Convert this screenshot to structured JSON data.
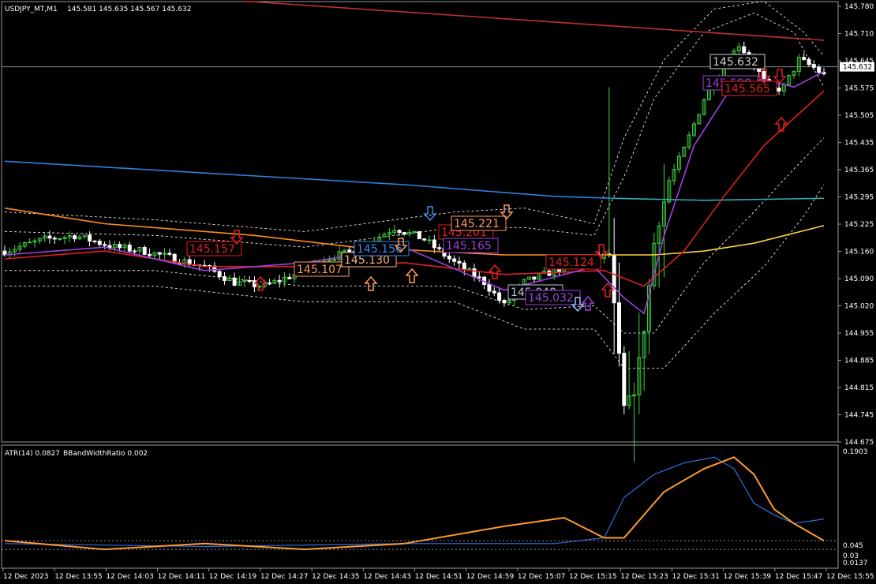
{
  "header": {
    "symbol": "USDJPY_MT,M1",
    "ohlc": "145.581 145.635 145.567 145.632"
  },
  "indicator_header": {
    "atr": "ATR(14) 0.0827",
    "bbwr": "BBandWidthRatio 0.002"
  },
  "colors": {
    "background": "#000000",
    "candle_up": "#3fcf3f",
    "candle_down": "#ffffff",
    "ma_red": "#e02020",
    "ma_purple": "#a040e0",
    "ma_orange": "#ff8c20",
    "ma_yellow": "#ffd040",
    "ma_blue": "#2f7fe0",
    "ma_teal": "#30b0b8",
    "ma_top": "#c03030",
    "bands": "#ffffff",
    "atr_line": "#2f6fe0",
    "bbwr_line": "#ff9a30"
  },
  "chart_data": [
    {
      "type": "candlestick",
      "title": "USDJPY_MT,M1",
      "ylim": [
        144.675,
        145.795
      ],
      "y_ticks": [
        "145.780",
        "145.710",
        "145.645",
        "145.575",
        "145.505",
        "145.435",
        "145.365",
        "145.295",
        "145.225",
        "145.160",
        "145.090",
        "145.020",
        "144.955",
        "144.885",
        "144.815",
        "144.745",
        "144.675"
      ],
      "current_price": "145.632",
      "x_ticks": [
        "12 Dec 2023",
        "12 Dec 13:55",
        "12 Dec 14:03",
        "12 Dec 14:11",
        "12 Dec 14:19",
        "12 Dec 14:27",
        "12 Dec 14:35",
        "12 Dec 14:43",
        "12 Dec 14:51",
        "12 Dec 14:59",
        "12 Dec 15:07",
        "12 Dec 15:15",
        "12 Dec 15:23",
        "12 Dec 15:31",
        "12 Dec 15:39",
        "12 Dec 15:47",
        "12 Dec 15:55"
      ],
      "anchors": [
        [
          0,
          145.16
        ],
        [
          8,
          145.19
        ],
        [
          14,
          145.2
        ],
        [
          22,
          145.17
        ],
        [
          28,
          145.16
        ],
        [
          34,
          145.14
        ],
        [
          40,
          145.12
        ],
        [
          46,
          145.08
        ],
        [
          52,
          145.07
        ],
        [
          58,
          145.1
        ],
        [
          64,
          145.14
        ],
        [
          70,
          145.16
        ],
        [
          78,
          145.22
        ],
        [
          84,
          145.19
        ],
        [
          90,
          145.13
        ],
        [
          96,
          145.08
        ],
        [
          100,
          145.02
        ],
        [
          104,
          145.08
        ],
        [
          112,
          145.12
        ],
        [
          118,
          145.14
        ],
        [
          121,
          145.15
        ],
        [
          124,
          144.76
        ],
        [
          126,
          144.8
        ],
        [
          128,
          144.96
        ],
        [
          130,
          145.18
        ],
        [
          133,
          145.34
        ],
        [
          136,
          145.42
        ],
        [
          140,
          145.55
        ],
        [
          144,
          145.63
        ],
        [
          147,
          145.69
        ],
        [
          150,
          145.64
        ],
        [
          153,
          145.57
        ],
        [
          156,
          145.58
        ],
        [
          159,
          145.65
        ],
        [
          162,
          145.63
        ],
        [
          164,
          145.61
        ]
      ],
      "price_labels": [
        {
          "text": "145.157",
          "color": "#e02020"
        },
        {
          "text": "145.107",
          "color": "#ff9a60"
        },
        {
          "text": "145.130",
          "color": "#ffb080"
        },
        {
          "text": "145.156",
          "color": "#3a8ae8"
        },
        {
          "text": "145.201",
          "color": "#e02020"
        },
        {
          "text": "145.221",
          "color": "#ff9a60"
        },
        {
          "text": "145.165",
          "color": "#a040e0"
        },
        {
          "text": "145.124",
          "color": "#e02020"
        },
        {
          "text": "145.040",
          "color": "#c0c0e0"
        },
        {
          "text": "145.032",
          "color": "#a040e0"
        },
        {
          "text": "145.632",
          "color": "#d0d0d0"
        },
        {
          "text": "145.598",
          "color": "#a040e0"
        },
        {
          "text": "145.565",
          "color": "#e02020"
        }
      ],
      "moving_averages": [
        {
          "color_key": "ma_top",
          "points": [
            [
              48,
              145.8
            ],
            [
              164,
              145.7
            ]
          ]
        },
        {
          "color_key": "ma_blue",
          "points": [
            [
              0,
              145.39
            ],
            [
              40,
              145.36
            ],
            [
              80,
              145.33
            ],
            [
              110,
              145.3
            ],
            [
              122,
              145.295
            ]
          ]
        },
        {
          "color_key": "ma_teal",
          "points": [
            [
              122,
              145.295
            ],
            [
              140,
              145.29
            ],
            [
              164,
              145.295
            ]
          ]
        },
        {
          "color_key": "ma_orange",
          "points": [
            [
              0,
              145.27
            ],
            [
              20,
              145.23
            ],
            [
              50,
              145.2
            ],
            [
              70,
              145.17
            ],
            [
              100,
              145.15
            ],
            [
              121,
              145.15
            ]
          ]
        },
        {
          "color_key": "ma_yellow",
          "points": [
            [
              121,
              145.15
            ],
            [
              130,
              145.15
            ],
            [
              140,
              145.16
            ],
            [
              150,
              145.18
            ],
            [
              164,
              145.225
            ]
          ]
        },
        {
          "color_key": "ma_red",
          "points": [
            [
              0,
              145.14
            ],
            [
              20,
              145.16
            ],
            [
              40,
              145.12
            ],
            [
              60,
              145.12
            ],
            [
              80,
              145.13
            ],
            [
              100,
              145.1
            ],
            [
              120,
              145.11
            ],
            [
              128,
              145.07
            ],
            [
              136,
              145.16
            ],
            [
              144,
              145.3
            ],
            [
              152,
              145.43
            ],
            [
              158,
              145.5
            ],
            [
              164,
              145.57
            ]
          ]
        },
        {
          "color_key": "ma_purple",
          "points": [
            [
              0,
              145.15
            ],
            [
              20,
              145.17
            ],
            [
              40,
              145.11
            ],
            [
              60,
              145.13
            ],
            [
              80,
              145.17
            ],
            [
              100,
              145.06
            ],
            [
              118,
              145.12
            ],
            [
              124,
              145.04
            ],
            [
              128,
              145.0
            ],
            [
              132,
              145.2
            ],
            [
              138,
              145.43
            ],
            [
              146,
              145.59
            ],
            [
              152,
              145.6
            ],
            [
              158,
              145.58
            ],
            [
              164,
              145.62
            ]
          ]
        }
      ],
      "bands": [
        {
          "points": [
            [
              0,
              145.21
            ],
            [
              30,
              145.2
            ],
            [
              60,
              145.17
            ],
            [
              90,
              145.22
            ],
            [
              104,
              145.22
            ],
            [
              118,
              145.2
            ],
            [
              124,
              145.35
            ],
            [
              130,
              145.55
            ],
            [
              140,
              145.72
            ],
            [
              150,
              145.77
            ],
            [
              158,
              145.72
            ],
            [
              164,
              145.58
            ]
          ]
        },
        {
          "points": [
            [
              0,
              145.11
            ],
            [
              30,
              145.11
            ],
            [
              60,
              145.07
            ],
            [
              90,
              145.07
            ],
            [
              104,
              145.01
            ],
            [
              118,
              145.02
            ],
            [
              124,
              144.95
            ],
            [
              130,
              144.95
            ],
            [
              140,
              145.13
            ],
            [
              150,
              145.26
            ],
            [
              158,
              145.37
            ],
            [
              164,
              145.45
            ]
          ]
        },
        {
          "points": [
            [
              0,
              145.07
            ],
            [
              30,
              145.07
            ],
            [
              60,
              145.03
            ],
            [
              90,
              145.03
            ],
            [
              104,
              144.96
            ],
            [
              118,
              144.96
            ],
            [
              124,
              144.86
            ],
            [
              132,
              144.86
            ],
            [
              142,
              145.0
            ],
            [
              152,
              145.12
            ],
            [
              160,
              145.25
            ],
            [
              164,
              145.33
            ]
          ]
        },
        {
          "points": [
            [
              0,
              145.26
            ],
            [
              30,
              145.24
            ],
            [
              60,
              145.21
            ],
            [
              90,
              145.26
            ],
            [
              104,
              145.27
            ],
            [
              118,
              145.23
            ],
            [
              124,
              145.45
            ],
            [
              132,
              145.65
            ],
            [
              142,
              145.78
            ],
            [
              152,
              145.8
            ],
            [
              160,
              145.72
            ],
            [
              164,
              145.66
            ]
          ]
        }
      ]
    },
    {
      "type": "line",
      "title": "ATR(14) 0.0827 BBandWidthRatio 0.002",
      "ylim": [
        0,
        0.2
      ],
      "y_ticks": [
        "0.1903",
        "0.045",
        "0.03",
        "0.0137"
      ],
      "series": [
        {
          "name": "ATR(14)",
          "color_key": "atr_line",
          "values": [
            [
              0,
              0.04
            ],
            [
              40,
              0.035
            ],
            [
              80,
              0.04
            ],
            [
              110,
              0.04
            ],
            [
              120,
              0.05
            ],
            [
              124,
              0.12
            ],
            [
              130,
              0.16
            ],
            [
              136,
              0.18
            ],
            [
              142,
              0.19
            ],
            [
              146,
              0.17
            ],
            [
              150,
              0.11
            ],
            [
              154,
              0.09
            ],
            [
              158,
              0.075
            ],
            [
              164,
              0.0827
            ]
          ]
        },
        {
          "name": "BBandWidthRatio",
          "color_key": "bbwr_line",
          "values": [
            [
              0,
              0.045
            ],
            [
              20,
              0.03
            ],
            [
              40,
              0.04
            ],
            [
              60,
              0.03
            ],
            [
              80,
              0.04
            ],
            [
              100,
              0.07
            ],
            [
              112,
              0.085
            ],
            [
              120,
              0.05
            ],
            [
              124,
              0.05
            ],
            [
              132,
              0.13
            ],
            [
              140,
              0.17
            ],
            [
              146,
              0.19
            ],
            [
              150,
              0.16
            ],
            [
              154,
              0.1
            ],
            [
              158,
              0.075
            ],
            [
              164,
              0.045
            ]
          ]
        }
      ]
    }
  ]
}
